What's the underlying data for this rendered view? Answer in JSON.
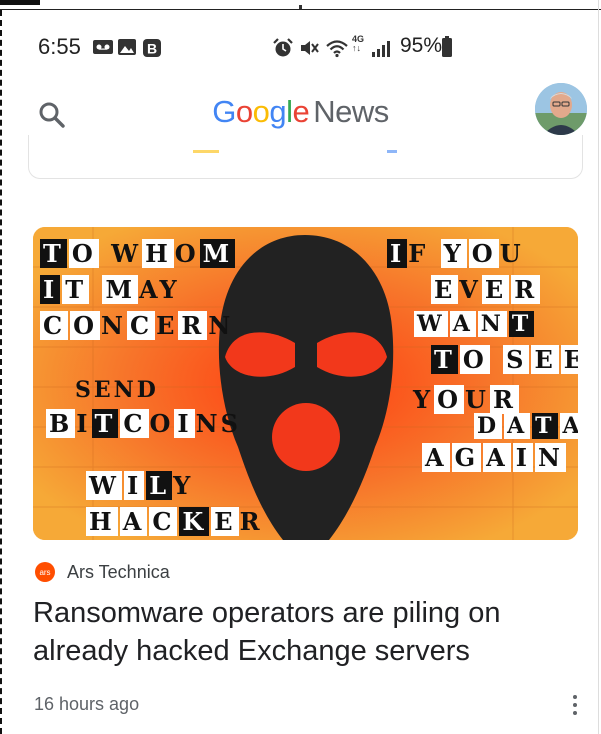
{
  "status_bar": {
    "time": "6:55",
    "battery": "95%",
    "network_badge": "4G",
    "left_icons": [
      "voicemail-icon",
      "image-icon",
      "b-app-icon"
    ],
    "right_icons": [
      "alarm-icon",
      "mute-icon",
      "wifi-icon",
      "data-icon",
      "signal-icon",
      "battery-icon"
    ]
  },
  "app_bar": {
    "brand_google": "Google",
    "brand_news": "News",
    "colors": {
      "blue": "#4285F4",
      "red": "#EA4335",
      "yellow": "#FBBC05",
      "green": "#34A853"
    }
  },
  "article": {
    "image": {
      "left_text": [
        "TO WHOM",
        "IT MAY",
        "CONCERN",
        "SEND",
        "BITCOINS",
        "WILY",
        "HACKER"
      ],
      "right_text": [
        "IF YOU",
        "EVER",
        "WANT",
        "TO SEE",
        "YOUR",
        "DATA",
        "AGAIN"
      ]
    },
    "source_logo": "ars",
    "source": "Ars Technica",
    "headline": "Ransomware operators are piling on already hacked Exchange servers",
    "time_ago": "16 hours ago"
  }
}
